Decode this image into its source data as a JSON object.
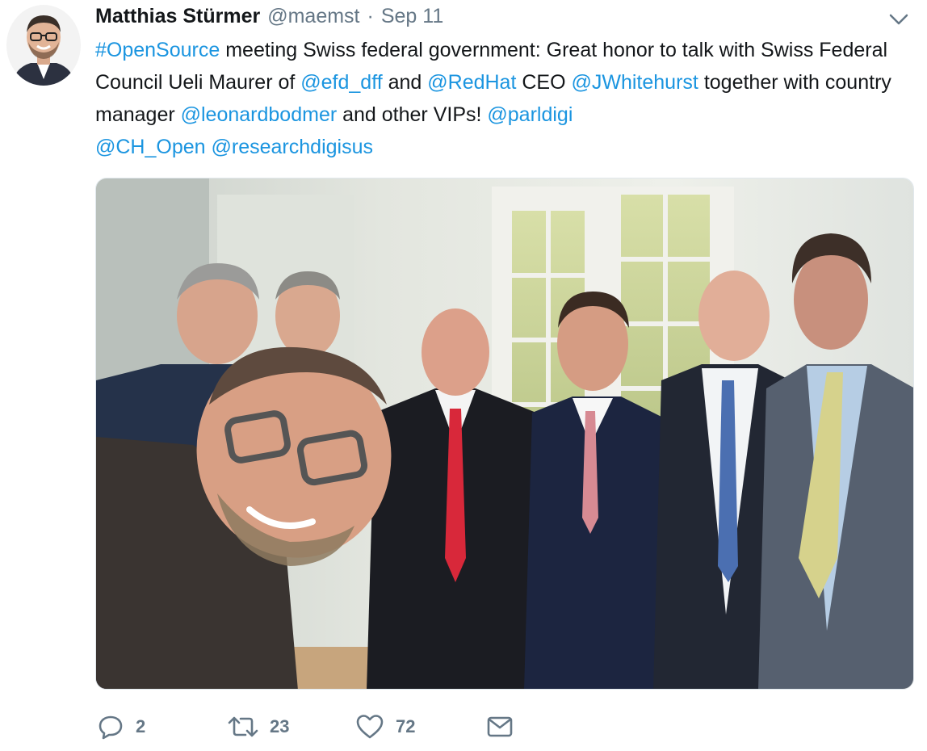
{
  "tweet": {
    "author": {
      "name": "Matthias Stürmer",
      "handle": "@maemst",
      "separator": "·",
      "date": "Sep 11"
    },
    "text": {
      "hashtag": "#OpenSource",
      "seg1": " meeting Swiss federal government: Great honor to talk with Swiss Federal Council Ueli Maurer of ",
      "mention1": "@efd_dff",
      "seg2": " and ",
      "mention2": "@RedHat",
      "seg3": " CEO ",
      "mention3": "@JWhitehurst",
      "seg4": " together with country manager ",
      "mention4": "@leonardbodmer",
      "seg5": " and other VIPs! ",
      "mention5": "@parldigi",
      "seg6": " ",
      "mention6": "@CH_Open",
      "seg7": " ",
      "mention7": "@researchdigisus"
    },
    "actions": {
      "reply_count": "2",
      "retweet_count": "23",
      "like_count": "72"
    },
    "colors": {
      "link": "#1b95e0",
      "muted": "#657786",
      "text": "#14171a"
    }
  }
}
